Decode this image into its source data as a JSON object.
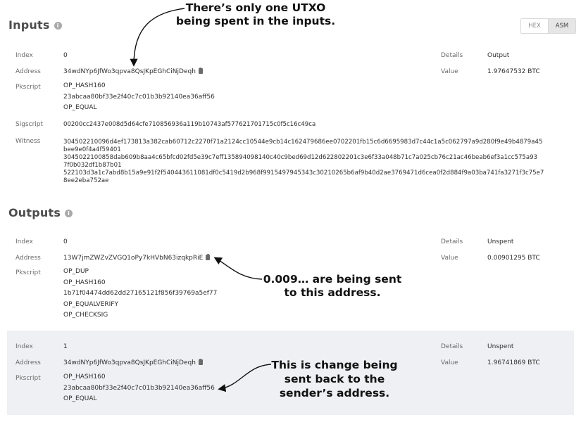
{
  "inputs": {
    "title": "Inputs",
    "format_toggle": {
      "hex": "HEX",
      "asm": "ASM",
      "active": "ASM"
    },
    "labels": {
      "index": "Index",
      "address": "Address",
      "pkscript": "Pkscript",
      "sigscript": "Sigscript",
      "witness": "Witness",
      "details": "Details",
      "value": "Value"
    },
    "index": "0",
    "address": "34wdNYp6JfWo3qpva8QsJKpEGhCiNjDeqh",
    "pkscript": [
      "OP_HASH160",
      "23abcaa80bf33e2f40c7c01b3b92140ea36aff56",
      "OP_EQUAL"
    ],
    "sigscript": "00200cc2437e008d5d64cfe710856936a119b10743af577621701715c0f5c16c49ca",
    "witness": [
      "304502210096d4ef173813a382cab60712c2270f71a2124cc10544e9cb14c162479686ee0702201fb15c6d6695983d7c44c1a5c062797a9d280f9e49b4879a45",
      "bee9e0f4a4f59401",
      "3045022100858dab609b8aa4c65bfcd02fd5e39c7eff135894098140c40c9bed69d12d622802201c3e6f33a048b71c7a025cb76c21ac46beab6ef3a1cc575a93",
      "7f0b032df1b87b01",
      "522103d3a1c7abd8b15a9e91f2f540443611081df0c5419d2b968f9915497945343c30210265b6af9b40d2ae3769471d6cea0f2d884f9a03ba741fa3271f3c75e7",
      "8ee2eba752ae"
    ],
    "details": "Output",
    "value": "1.97647532 BTC"
  },
  "outputs": {
    "title": "Outputs",
    "labels": {
      "index": "Index",
      "address": "Address",
      "pkscript": "Pkscript",
      "details": "Details",
      "value": "Value"
    },
    "items": [
      {
        "index": "0",
        "address": "13W7jmZWZvZVGQ1oPy7kHVbN63izqkpRiE",
        "pkscript": [
          "OP_DUP",
          "OP_HASH160",
          "1b71f04474dd62dd27165121f856f39769a5ef77",
          "OP_EQUALVERIFY",
          "OP_CHECKSIG"
        ],
        "details": "Unspent",
        "value": "0.00901295 BTC"
      },
      {
        "index": "1",
        "address": "34wdNYp6JfWo3qpva8QsJKpEGhCiNjDeqh",
        "pkscript": [
          "OP_HASH160",
          "23abcaa80bf33e2f40c7c01b3b92140ea36aff56",
          "OP_EQUAL"
        ],
        "details": "Unspent",
        "value": "1.96741869 BTC"
      }
    ]
  },
  "annotations": {
    "utxo": [
      "There’s only one UTXO",
      "being spent in the inputs."
    ],
    "sent": [
      "0.009… are being sent",
      "to this address."
    ],
    "change": [
      "This is change being",
      "sent back to the",
      "sender’s address."
    ]
  },
  "icons": {
    "info": "info-circle-icon",
    "copy": "clipboard-icon"
  }
}
